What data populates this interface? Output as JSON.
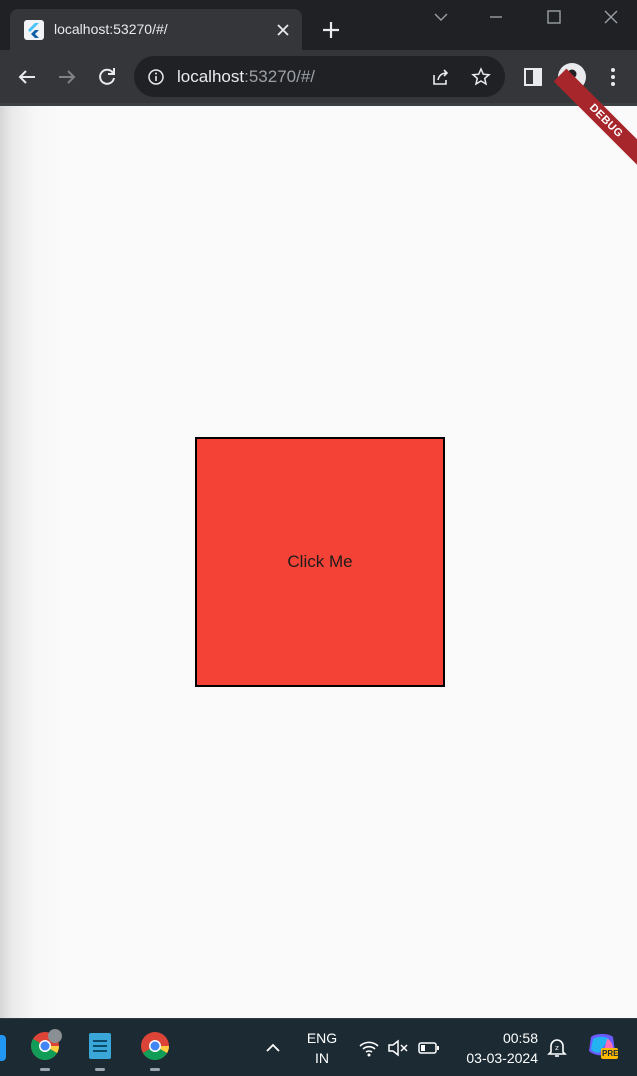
{
  "browser": {
    "tab": {
      "title": "localhost:53270/#/",
      "favicon": "flutter-icon"
    },
    "address": {
      "host": "localhost",
      "rest": ":53270/#/"
    }
  },
  "app": {
    "debug_banner": "DEBUG",
    "button": {
      "label": "Click Me",
      "color": "#f44336",
      "border_color": "#000000"
    }
  },
  "taskbar": {
    "language": {
      "line1": "ENG",
      "line2": "IN"
    },
    "clock": {
      "time": "00:58",
      "date": "03-03-2024"
    },
    "apps": [
      "chrome-profile-icon",
      "notepad-icon",
      "chrome-icon"
    ],
    "copilot_badge": "PRE"
  }
}
